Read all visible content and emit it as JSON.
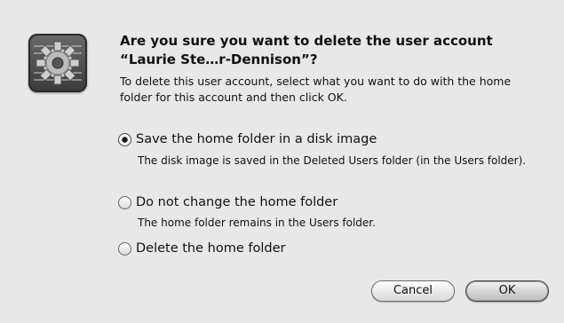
{
  "dialog": {
    "icon": "system-preferences-gear-icon",
    "title": "Are you sure you want to delete the user account “Laurie Ste…r-Dennison”?",
    "message": "To delete this user account, select what you want to do with the home folder for this account and then click OK.",
    "options": [
      {
        "label": "Save the home folder in a disk image",
        "description": "The disk image is saved in the Deleted Users folder (in the Users folder).",
        "selected": true
      },
      {
        "label": "Do not change the home folder",
        "description": "The home folder remains in the Users folder.",
        "selected": false
      },
      {
        "label": "Delete the home folder",
        "description": "",
        "selected": false
      }
    ],
    "buttons": {
      "cancel": "Cancel",
      "ok": "OK"
    }
  }
}
